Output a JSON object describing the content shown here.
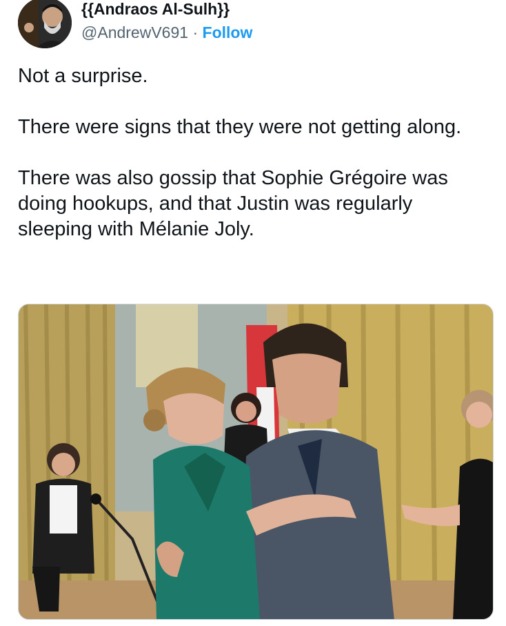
{
  "tweet": {
    "author": {
      "display_name": "{{Andraos Al-Sulh}}",
      "handle": "@AndrewV691",
      "separator": " · ",
      "follow_label": "Follow",
      "avatar": "profile-photo"
    },
    "paragraphs": [
      "Not a surprise.",
      "There were signs that they were not getting along.",
      "There was also gossip that Sophie Grégoire was doing hookups, and that Justin was regularly sleeping with Mélanie Joly."
    ],
    "media": {
      "type": "photo",
      "description_icon": "photo"
    }
  },
  "colors": {
    "text": "#0f1419",
    "secondary": "#536471",
    "link": "#1d9bf0",
    "border": "#cfd9de"
  }
}
